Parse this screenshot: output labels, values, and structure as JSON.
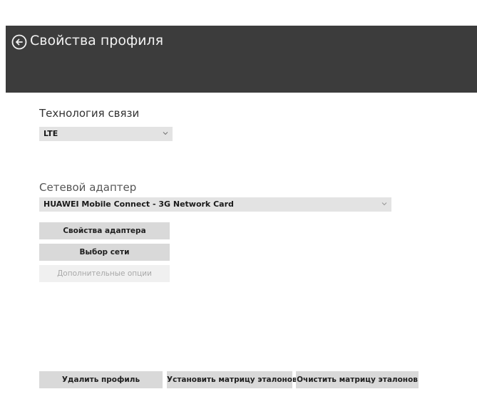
{
  "header": {
    "title": "Свойства профиля"
  },
  "technology": {
    "label": "Технология связи",
    "selected": "LTE"
  },
  "adapter": {
    "label": "Сетевой адаптер",
    "selected": "HUAWEI Mobile Connect - 3G Network Card"
  },
  "actions": {
    "adapter_properties": "Свойства адаптера",
    "network_select": "Выбор сети",
    "additional_options": "Дополнительные опции"
  },
  "footer": {
    "delete_profile": "Удалить профиль",
    "set_matrix": "Установить матрицу эталонов",
    "clear_matrix": "Очистить матрицу эталонов"
  },
  "colors": {
    "header_bg": "#3c3c3c",
    "button_bg": "#d9d9d9",
    "select_bg": "#e3e3e3",
    "disabled_text": "#a8a8a8"
  }
}
